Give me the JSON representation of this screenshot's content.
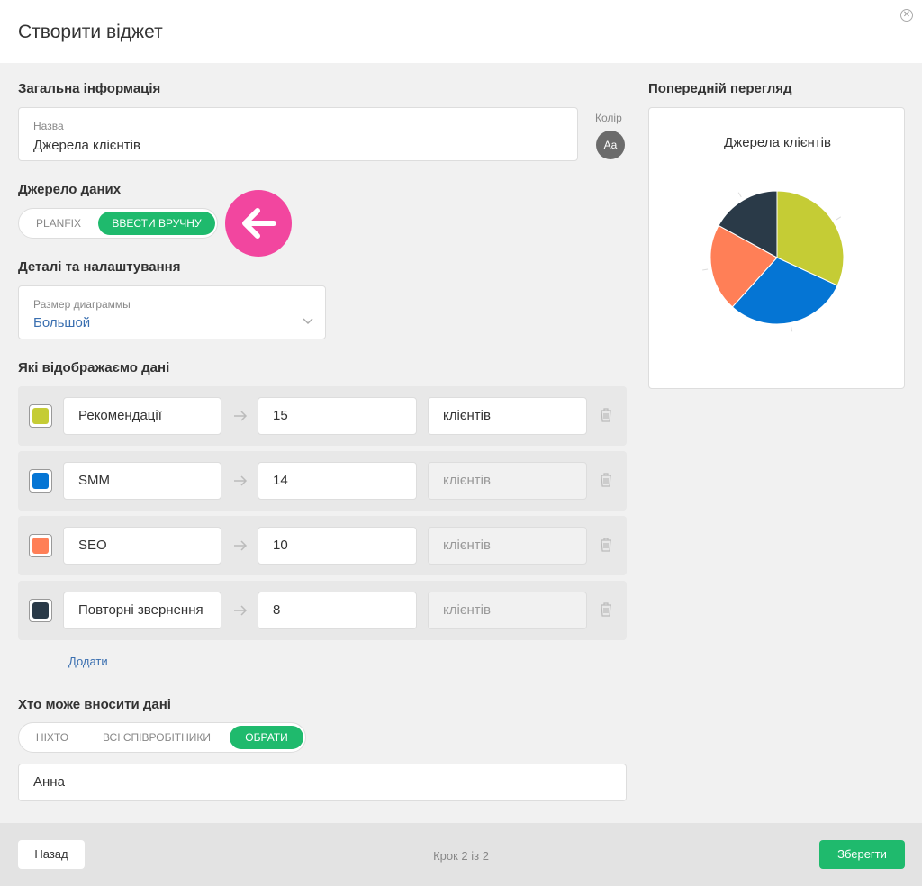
{
  "header": {
    "title": "Створити віджет",
    "close_icon": "close-icon"
  },
  "general": {
    "section_label": "Загальна інформація",
    "name_label": "Назва",
    "name_value": "Джерела клієнтів",
    "color_label": "Колір",
    "color_button_text": "Aa"
  },
  "source": {
    "section_label": "Джерело даних",
    "options": [
      "PLANFIX",
      "ВВЕСТИ ВРУЧНУ"
    ],
    "selected": "ВВЕСТИ ВРУЧНУ",
    "highlight_color": "#f2469f"
  },
  "details": {
    "section_label": "Деталі та налаштування",
    "size_label": "Размер диаграммы",
    "size_value": "Большой"
  },
  "data_section": {
    "section_label": "Які відображаємо дані",
    "add_link": "Додати",
    "rows": [
      {
        "color": "#c5cc35",
        "name": "Рекомендації",
        "value": "15",
        "unit": "клієнтів",
        "unit_editable": true
      },
      {
        "color": "#0575d4",
        "name": "SMM",
        "value": "14",
        "unit": "клієнтів",
        "unit_editable": false
      },
      {
        "color": "#ff7f57",
        "name": "SEO",
        "value": "10",
        "unit": "клієнтів",
        "unit_editable": false
      },
      {
        "color": "#2a3a48",
        "name": "Повторні звернення",
        "value": "8",
        "unit": "клієнтів",
        "unit_editable": false
      }
    ]
  },
  "access": {
    "section_label": "Хто може вносити дані",
    "options": [
      "НІХТО",
      "ВСІ СПІВРОБІТНИКИ",
      "ОБРАТИ"
    ],
    "selected": "ОБРАТИ",
    "selected_person": "Анна"
  },
  "preview": {
    "section_label": "Попередній перегляд",
    "chart_title": "Джерела клієнтів"
  },
  "chart_data": {
    "type": "pie",
    "title": "Джерела клієнтів",
    "categories": [
      "Рекомендації",
      "SMM",
      "SEO",
      "Повторні звернення"
    ],
    "values": [
      15,
      14,
      10,
      8
    ],
    "colors": [
      "#c5cc35",
      "#0575d4",
      "#ff7f57",
      "#2a3a48"
    ]
  },
  "footer": {
    "back_label": "Назад",
    "step_text": "Крок 2 із 2",
    "save_label": "Зберегти"
  },
  "colors": {
    "accent": "#1fba6d",
    "link": "#3a6fb0"
  }
}
